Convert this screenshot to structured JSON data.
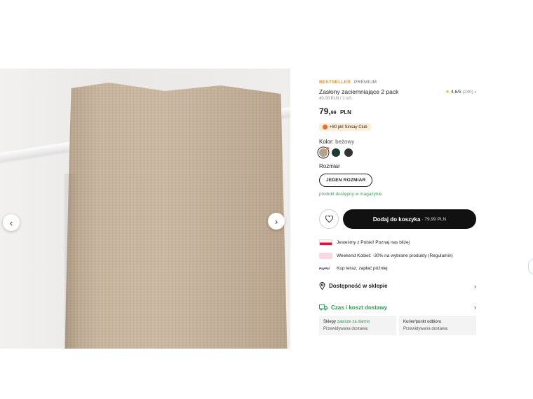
{
  "gallery": {
    "prev_icon": "‹",
    "next_icon": "›"
  },
  "product": {
    "tag_bestseller": "BESTSELLER",
    "tag_premium": "PREMIUM",
    "title": "Zasłony zaciemniające 2 pack",
    "rating": "4,6/5",
    "rating_count": "(240)",
    "unit_price": "40,00 PLN / 1 szt",
    "price_int": "79,",
    "price_dec": "99",
    "price_currency": "PLN",
    "club": "+80 pkt Sinsay Club",
    "color_label": "Kolor:",
    "color_value": "beżowy",
    "colors": [
      "#b5a088",
      "#1d3b34",
      "#333333"
    ],
    "size_label": "Rozmiar",
    "size_option": "JEDEN ROZMIAR",
    "stock": "produkt dostępny w magazynie",
    "add_to_cart": "Dodaj do koszyka",
    "add_to_cart_price": "· 79,99 PLN"
  },
  "info": {
    "poland": "Jesteśmy z Polski! Poznaj nas bliżej",
    "weekend": "Weekend Kobiet: -30% na wybrane produkty (Regulamin)",
    "paypal_logo": "PayPal",
    "paypal": "Kup teraz, zapłać później"
  },
  "accordion": {
    "store": "Dostępność w sklepie",
    "delivery": "Czas i koszt dostawy"
  },
  "delivery": {
    "stores_label": "Sklepy",
    "stores_free": "zawsze za darmo",
    "stores_eta": "Przewidywana dostawa:",
    "courier_label": "Kurier/punkt odbioru",
    "courier_eta": "Przewidywana dostawa:"
  },
  "colors": {
    "accent_orange": "#e2962b",
    "green": "#2f9a53",
    "cart_button": "#111111"
  }
}
